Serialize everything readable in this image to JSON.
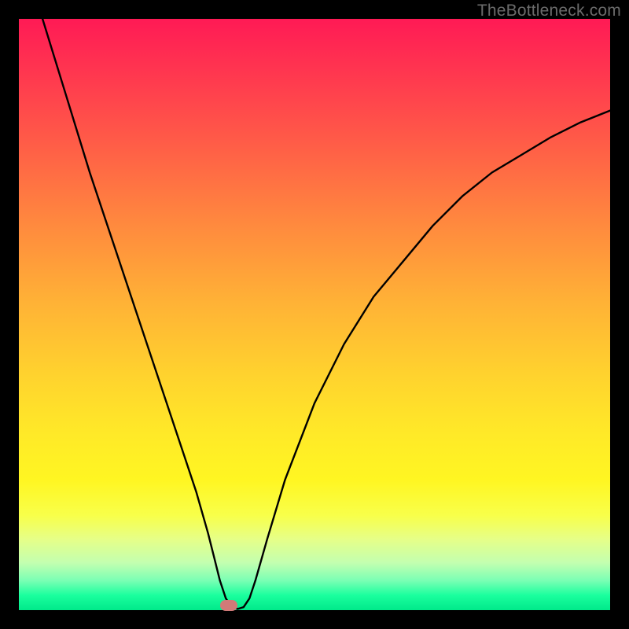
{
  "watermark": "TheBottleneck.com",
  "marker": {
    "x_pct": 35.5,
    "y_pct": 99.2
  },
  "chart_data": {
    "type": "line",
    "title": "",
    "xlabel": "",
    "ylabel": "",
    "xlim": [
      0,
      100
    ],
    "ylim": [
      0,
      100
    ],
    "series": [
      {
        "name": "bottleneck-curve",
        "x": [
          4,
          8,
          12,
          16,
          20,
          24,
          28,
          30,
          32,
          33,
          34,
          35,
          36,
          37,
          38,
          39,
          40,
          42,
          45,
          50,
          55,
          60,
          65,
          70,
          75,
          80,
          85,
          90,
          95,
          100
        ],
        "y": [
          100,
          87,
          74,
          62,
          50,
          38,
          26,
          20,
          13,
          9,
          5,
          2,
          0.5,
          0.2,
          0.5,
          2,
          5,
          12,
          22,
          35,
          45,
          53,
          59,
          65,
          70,
          74,
          77,
          80,
          82.5,
          84.5
        ]
      }
    ],
    "marker_point": {
      "x": 35.5,
      "y": 0.8
    },
    "background_gradient": {
      "top": "#ff1a55",
      "mid": "#ffd22e",
      "bottom": "#00e98a"
    }
  }
}
